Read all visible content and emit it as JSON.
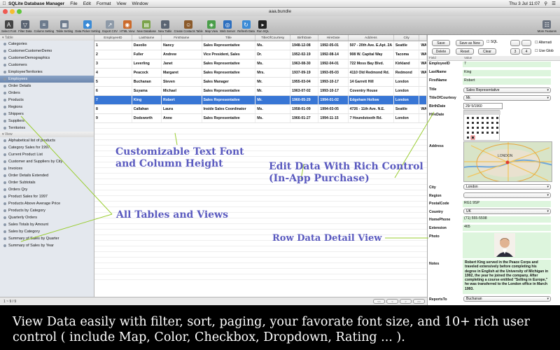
{
  "menubar": {
    "apple": "",
    "app_name": "SQLite Database Manager",
    "items": [
      "File",
      "Edit",
      "Format",
      "View",
      "Window"
    ],
    "clock": "Thu 3 Jul  11:07"
  },
  "window": {
    "title": "aaa.bundle"
  },
  "toolbar": {
    "items": [
      {
        "label": "Select Font",
        "icon": "font-icon",
        "color": "#444444",
        "glyph": "A"
      },
      {
        "label": "Filter Data",
        "icon": "filter-icon",
        "color": "#5a6472",
        "glyph": "▽"
      },
      {
        "label": "Column Setting",
        "icon": "columns-icon",
        "color": "#6d7b8d",
        "glyph": "≡"
      },
      {
        "label": "Table Setting",
        "icon": "table-icon",
        "color": "#6d7b8d",
        "glyph": "▦"
      },
      {
        "label": "Data Picker Setting",
        "icon": "picker-icon",
        "color": "#3b8bd6",
        "glyph": "◆"
      },
      {
        "label": "Export CSV",
        "icon": "export-icon",
        "color": "#8e9aa8",
        "glyph": "↗"
      },
      {
        "label": "HTML View",
        "icon": "html-icon",
        "color": "#cc6b2c",
        "glyph": "◉"
      },
      {
        "label": "New Database",
        "icon": "database-icon",
        "color": "#7aa34a",
        "glyph": "▤"
      },
      {
        "label": "New Table",
        "icon": "new-table-icon",
        "color": "#5a6472",
        "glyph": "+"
      },
      {
        "label": "Create Contacts Table",
        "icon": "contacts-icon",
        "color": "#8b5a2b",
        "glyph": "☺"
      },
      {
        "label": "Map View",
        "icon": "map-icon",
        "color": "#4a9e4a",
        "glyph": "◈"
      },
      {
        "label": "Web Server",
        "icon": "globe-icon",
        "color": "#2d6fbf",
        "glyph": "◎"
      },
      {
        "label": "Refresh Data",
        "icon": "refresh-icon",
        "color": "#3b8bd6",
        "glyph": "↻"
      },
      {
        "label": "Run SQL",
        "icon": "sql-icon",
        "color": "#222222",
        "glyph": "▸"
      }
    ],
    "more": "More Features"
  },
  "sidebar": {
    "table_header": "Table",
    "tables": [
      "Categories",
      "CustomerCustomerDemo",
      "CustomerDemographics",
      "Customers",
      "EmployeeTerritories",
      "Employees",
      "Order Details",
      "Orders",
      "Products",
      "Regions",
      "Shippers",
      "Suppliers",
      "Territories"
    ],
    "selected": "Employees",
    "view_header": "View",
    "views": [
      "Alphabetical list of products",
      "Category Sales for 1997",
      "Current Product List",
      "Customer and Suppliers by City",
      "Invoices",
      "Order Details Extended",
      "Order Subtotals",
      "Orders Qry",
      "Product Sales for 1997",
      "Products Above Average Price",
      "Products by Category",
      "Quarterly Orders",
      "Sales Totals by Amount",
      "Sales by Category",
      "Summary of Sales by Quarter",
      "Summary of Sales by Year"
    ],
    "footer": "1 ~ 9 / 9"
  },
  "grid": {
    "columns": [
      "EmployeeID",
      "LastName",
      "FirstName",
      "Title",
      "TitleOfCourtesy",
      "BirthDate",
      "HireDate",
      "Address",
      "City",
      ""
    ],
    "rows": [
      [
        "1",
        "Davolio",
        "Nancy",
        "Sales Representative",
        "Ms.",
        "1948-12-08",
        "1992-05-01",
        "507 - 20th Ave. E.Apt. 2A",
        "Seattle",
        "WA"
      ],
      [
        "2",
        "Fuller",
        "Andrew",
        "Vice President, Sales",
        "Dr.",
        "1952-02-19",
        "1992-08-14",
        "908 W. Capital Way",
        "Tacoma",
        "WA"
      ],
      [
        "3",
        "Leverling",
        "Janet",
        "Sales Representative",
        "Ms.",
        "1963-08-30",
        "1992-04-01",
        "722 Moss Bay Blvd.",
        "Kirkland",
        "WA"
      ],
      [
        "4",
        "Peacock",
        "Margaret",
        "Sales Representative",
        "Mrs.",
        "1937-09-19",
        "1993-05-03",
        "4110 Old Redmond Rd.",
        "Redmond",
        "WA"
      ],
      [
        "5",
        "Buchanan",
        "Steven",
        "Sales Manager",
        "Mr.",
        "1955-03-04",
        "1993-10-17",
        "14 Garrett Hill",
        "London",
        ""
      ],
      [
        "6",
        "Suyama",
        "Michael",
        "Sales Representative",
        "Mr.",
        "1963-07-02",
        "1993-10-17",
        "Coventry House",
        "London",
        ""
      ],
      [
        "7",
        "King",
        "Robert",
        "Sales Representative",
        "Mr.",
        "1960-05-29",
        "1994-01-02",
        "Edgeham Hollow",
        "London",
        ""
      ],
      [
        "8",
        "Callahan",
        "Laura",
        "Inside Sales Coordinator",
        "Ms.",
        "1958-01-09",
        "1994-03-05",
        "4726 - 11th Ave. N.E.",
        "Seattle",
        "WA"
      ],
      [
        "9",
        "Dodsworth",
        "Anne",
        "Sales Representative",
        "Ms.",
        "1966-01-27",
        "1994-11-15",
        "7 Houndstooth Rd.",
        "London",
        ""
      ]
    ],
    "selected_row": 6,
    "pager": [
      "<<",
      "<",
      ">",
      ">>"
    ]
  },
  "detail": {
    "buttons": {
      "save": "Save",
      "save_as_new": "Save as New",
      "sql": "SQL",
      "delete": "Delete",
      "reset": "Reset",
      "clear": "Clear"
    },
    "steppers": [
      "3",
      "4"
    ],
    "checks": {
      "alternate": "Alternati",
      "use_global": "Use Glob"
    },
    "header": {
      "field": "Field",
      "value": "Value"
    },
    "fields": {
      "employee_id": {
        "label": "EmployeeID",
        "value": "7"
      },
      "last_name": {
        "label": "LastName",
        "value": "King"
      },
      "first_name": {
        "label": "FirstName",
        "value": "Robert"
      },
      "title": {
        "label": "Title",
        "value": "Sales Representative"
      },
      "courtesy": {
        "label": "TitleOfCourtesy",
        "value": "Mr."
      },
      "birth": {
        "label": "BirthDate",
        "value": "29/ 5/1960"
      },
      "hire": {
        "label": "HireDate"
      },
      "address": {
        "label": "Address"
      },
      "city": {
        "label": "City",
        "value": "London"
      },
      "region": {
        "label": "Region"
      },
      "postal": {
        "label": "PostalCode",
        "value": "RG1 9SP"
      },
      "country": {
        "label": "Country",
        "value": "UK"
      },
      "phone": {
        "label": "HomePhone",
        "value": "(71) 555-5598"
      },
      "ext": {
        "label": "Extension",
        "value": "465"
      },
      "photo": {
        "label": "Photo"
      },
      "notes": {
        "label": "Notes",
        "value": "Robert King served in the Peace Corps and traveled extensively before completing his degree in English at the University of Michigan in 1992, the year he joined the company.  After completing a course entitled \"Selling in Europe,\" he was transferred to the London office in March 1993."
      },
      "reports": {
        "label": "ReportsTo",
        "value": "Buchanan"
      }
    },
    "map": {
      "label": "LONDON"
    }
  },
  "overlays": {
    "font": "Customizable Text Font",
    "font2": "and Column Height",
    "rich": "Edit Data With Rich Control",
    "rich2": "(In-App Purchase)",
    "tables": "All Tables and Views",
    "detail": "Row Data Detail View"
  },
  "caption": "View Data easily with filter, sort, paging, your favorate font size, and 10+ rich user control ( include Map, Color, Checkbox, Dropdown, Rating ... )."
}
